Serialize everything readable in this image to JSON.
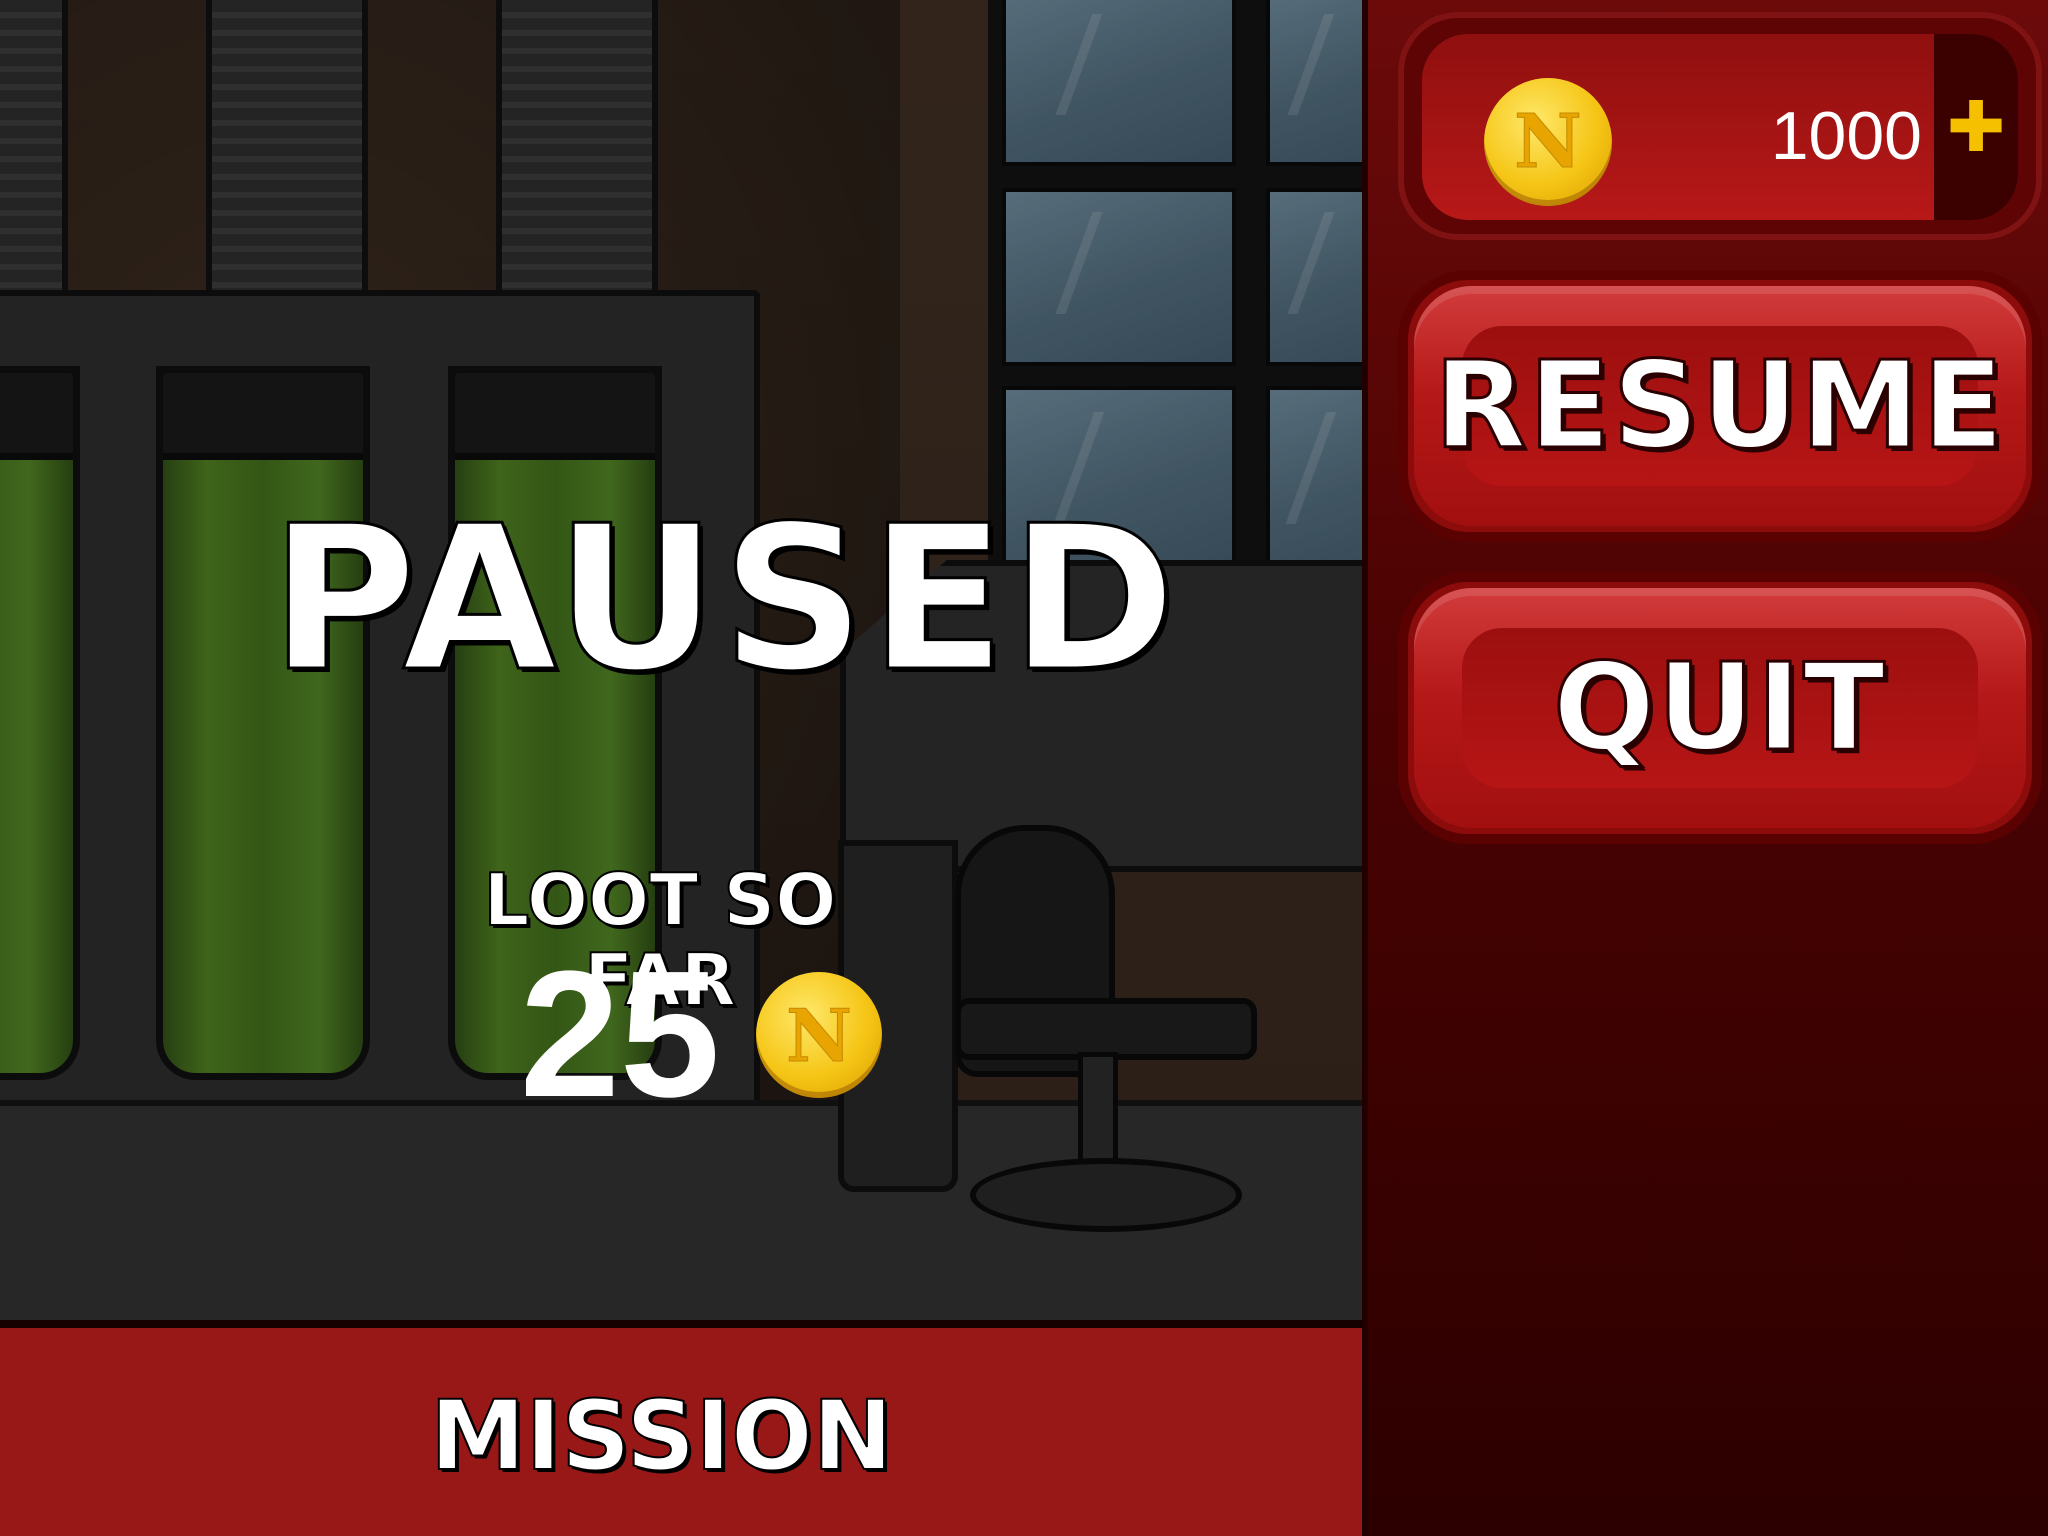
{
  "pause_screen": {
    "title": "PAUSED",
    "loot_label": "LOOT SO FAR",
    "loot_value": "25",
    "coin_letter": "N"
  },
  "currency": {
    "amount": "1000",
    "coin_letter": "N",
    "add_icon": "plus-icon",
    "add_glyph": "✚"
  },
  "menu": {
    "resume_label": "RESUME",
    "quit_label": "QUIT"
  },
  "mission_bar": {
    "label": "MISSION"
  },
  "colors": {
    "panel_red": "#b51818",
    "coin_gold": "#f5c515",
    "plus_gold": "#f5c000"
  }
}
